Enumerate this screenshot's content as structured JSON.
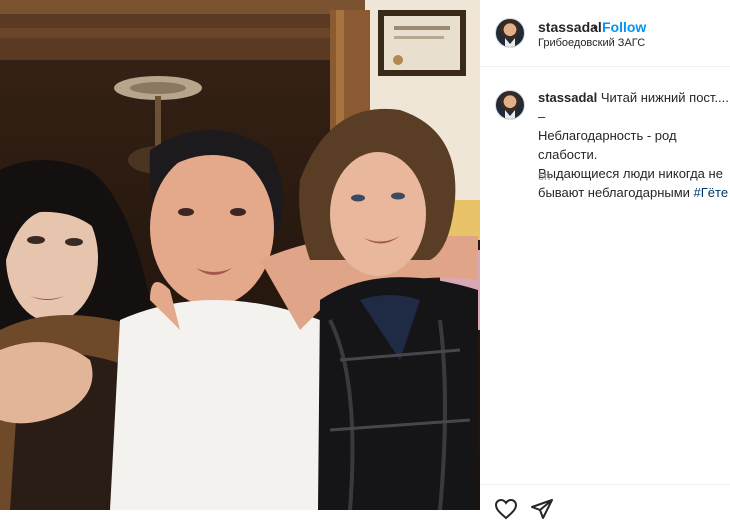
{
  "post": {
    "username": "stassadal",
    "separator": "•",
    "follow_label": "Follow",
    "location": "Грибоедовский ЗАГС",
    "caption_username": "stassadal",
    "caption_text": " Читай нижний пост.... –\nНеблагодарность - род слабости.\nВыдающиеся люди никогда не\nбывают неблагодарными ",
    "hashtag": "#Гёте",
    "time": "5h"
  },
  "icons": {
    "like": "heart-icon",
    "share": "paper-plane-icon",
    "avatar": "profile-avatar"
  },
  "colors": {
    "accent": "#0095f6",
    "text": "#262626",
    "muted": "#8e8e8e",
    "hashtag": "#00376b",
    "border": "#efefef"
  }
}
